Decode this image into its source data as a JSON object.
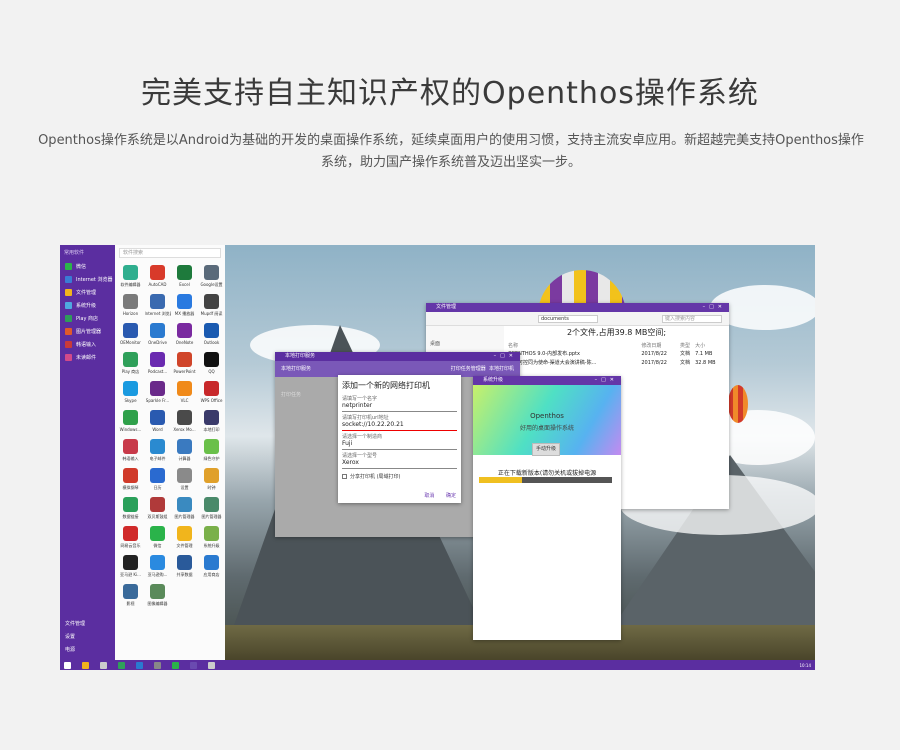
{
  "headline": "完美支持自主知识产权的Openthos操作系统",
  "intro": "Openthos操作系统是以Android为基础的开发的桌面操作系统，延续桌面用户的使用习惯，支持主流安卓应用。新超越完美支持Openthos操作系统，助力国产操作系统普及迈出坚实一步。",
  "launcher": {
    "header": "常用软件",
    "items": [
      {
        "label": "微信",
        "color": "#2cb34a"
      },
      {
        "label": "Internet 浏览器",
        "color": "#3a7bd5"
      },
      {
        "label": "文件管理",
        "color": "#f1b51c"
      },
      {
        "label": "系统升级",
        "color": "#4fa8e0"
      },
      {
        "label": "Play 商店",
        "color": "#2f9c5a"
      },
      {
        "label": "图片管理器",
        "color": "#e05a2a"
      },
      {
        "label": "韩语输入",
        "color": "#c93a3a"
      },
      {
        "label": "未读邮件",
        "color": "#d24a8a"
      }
    ],
    "bottom": [
      "文件管理",
      "设置",
      "电源"
    ]
  },
  "apps": {
    "search_placeholder": "软件搜索",
    "items": [
      {
        "label": "软件编辑器",
        "color": "#2fae8e"
      },
      {
        "label": "AutoCAD",
        "color": "#d83a2a"
      },
      {
        "label": "Excel",
        "color": "#1e7a3c"
      },
      {
        "label": "Google设置",
        "color": "#5a6a7a"
      },
      {
        "label": "Horizon",
        "color": "#7a7a7a"
      },
      {
        "label": "Internet 浏览器",
        "color": "#3a6ab0"
      },
      {
        "label": "MX 播放器",
        "color": "#2a7ae0"
      },
      {
        "label": "Mupdf 阅读",
        "color": "#444"
      },
      {
        "label": "OEMonitor",
        "color": "#2a5ab0"
      },
      {
        "label": "OneDrive",
        "color": "#2a7ad0"
      },
      {
        "label": "OneNote",
        "color": "#7a2aa0"
      },
      {
        "label": "Outlook",
        "color": "#1a5ab0"
      },
      {
        "label": "Play 商店",
        "color": "#2fa05a"
      },
      {
        "label": "Podcast...",
        "color": "#6a2ab0"
      },
      {
        "label": "PowerPoint",
        "color": "#d0452a"
      },
      {
        "label": "QQ",
        "color": "#111"
      },
      {
        "label": "Skype",
        "color": "#1a9ae0"
      },
      {
        "label": "Sparkle Fr...",
        "color": "#6a2a8a"
      },
      {
        "label": "VLC",
        "color": "#f08a1a"
      },
      {
        "label": "WPS Office",
        "color": "#c8282a"
      },
      {
        "label": "Windows...",
        "color": "#2fa04a"
      },
      {
        "label": "Word",
        "color": "#2a5ab0"
      },
      {
        "label": "Xerox Mo...",
        "color": "#4a4a4a"
      },
      {
        "label": "本地打印",
        "color": "#3a3a6a"
      },
      {
        "label": "韩语输入",
        "color": "#c83a4a"
      },
      {
        "label": "电子邮件",
        "color": "#2a8ad0"
      },
      {
        "label": "计算器",
        "color": "#3a7ac0"
      },
      {
        "label": "绿色守护",
        "color": "#6ac04a"
      },
      {
        "label": "模拟钢琴",
        "color": "#d03a2a"
      },
      {
        "label": "日历",
        "color": "#2a6ad0"
      },
      {
        "label": "设置",
        "color": "#8a8a8a"
      },
      {
        "label": "时钟",
        "color": "#e0a02a"
      },
      {
        "label": "数据链接",
        "color": "#2aa05a"
      },
      {
        "label": "双贝斯鼓组",
        "color": "#b03a3a"
      },
      {
        "label": "图片管理器",
        "color": "#3a8ac0"
      },
      {
        "label": "图片管理器",
        "color": "#4a8a6a"
      },
      {
        "label": "网易云音乐",
        "color": "#d02a2a"
      },
      {
        "label": "微信",
        "color": "#2ab34a"
      },
      {
        "label": "文件管理",
        "color": "#f1b51c"
      },
      {
        "label": "系统升级",
        "color": "#7ab04a"
      },
      {
        "label": "亚马逊 Ki...",
        "color": "#222"
      },
      {
        "label": "亚马逊购...",
        "color": "#2a8ae0"
      },
      {
        "label": "共享数据",
        "color": "#2a5a9a"
      },
      {
        "label": "应用商店",
        "color": "#2a7ad0"
      },
      {
        "label": "影视",
        "color": "#3a6a9a"
      },
      {
        "label": "图像编辑器",
        "color": "#5a8a5a"
      }
    ]
  },
  "file_manager": {
    "title": "文件管理",
    "path": "documents",
    "search_placeholder": "键入搜索内容",
    "sidebar": "桌面",
    "status": "2个文件,占用39.8 MB空间;",
    "columns": [
      "名称",
      "修改日期",
      "类型",
      "大小"
    ],
    "rows": [
      [
        "OPENTHOS 9.0-内部发布.pptx",
        "2017/8/22",
        "文档",
        "7.1 MB"
      ],
      [
        "自主可控同为使命-渠道大会演讲稿-陈...",
        "2017/8/22",
        "文档",
        "32.8 MB"
      ]
    ]
  },
  "print_manager": {
    "title": "本地打印服务",
    "subtitle": "本地打印服务",
    "tabs": "打印任务管理器",
    "tabs2": "本地打印机",
    "side_label": "打印任务"
  },
  "dialog": {
    "title": "添加一个新的网络打印机",
    "name_label": "请填写一个名字",
    "name_value": "netprinter",
    "url_label": "请填写打印机url地址",
    "url_value": "socket://10.22.20.21",
    "brand_label": "请选择一个制造商",
    "brand_value": "Fuji",
    "model_label": "请选择一个型号",
    "model_value": "Xerox",
    "share_label": "分享打印机 (局域打印)",
    "cancel": "取消",
    "ok": "确定"
  },
  "upgrade": {
    "title": "系统升级",
    "hero_title": "Openthos",
    "hero_sub": "好用的桌面操作系统",
    "button": "手动升级",
    "message": "正在下载新版本(请勿关机或拔掉电源",
    "progress": 0.32
  },
  "taskbar": {
    "time": "10:14"
  }
}
